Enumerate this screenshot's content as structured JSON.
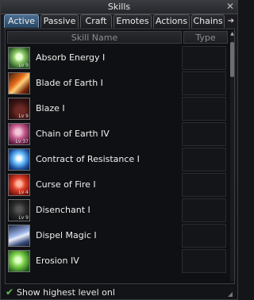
{
  "window": {
    "title": "Skills",
    "close": "✕"
  },
  "tabs": [
    {
      "label": "Active",
      "active": true
    },
    {
      "label": "Passive"
    },
    {
      "label": "Craft"
    },
    {
      "label": "Emotes"
    },
    {
      "label": "Actions"
    },
    {
      "label": "Chains"
    }
  ],
  "tab_scroll_arrow": "➔",
  "table": {
    "columns": [
      "Skill Name",
      "Type"
    ],
    "rows": [
      {
        "name": "Absorb Energy I",
        "icon": "absorb-energy-icon",
        "level": "Lv 9"
      },
      {
        "name": "Blade of Earth I",
        "icon": "blade-of-earth-icon",
        "level": ""
      },
      {
        "name": "Blaze I",
        "icon": "blaze-icon",
        "level": "Lv 9"
      },
      {
        "name": "Chain of Earth IV",
        "icon": "chain-of-earth-icon",
        "level": "Lv 37"
      },
      {
        "name": "Contract of Resistance I",
        "icon": "contract-of-resistance-icon",
        "level": ""
      },
      {
        "name": "Curse of Fire I",
        "icon": "curse-of-fire-icon",
        "level": "Lv 4"
      },
      {
        "name": "Disenchant I",
        "icon": "disenchant-icon",
        "level": "Lv 9"
      },
      {
        "name": "Dispel Magic I",
        "icon": "dispel-magic-icon",
        "level": ""
      },
      {
        "name": "Erosion IV",
        "icon": "erosion-icon",
        "level": ""
      }
    ]
  },
  "footer": {
    "checkbox_label": "Show highest level onl",
    "checked": true
  }
}
